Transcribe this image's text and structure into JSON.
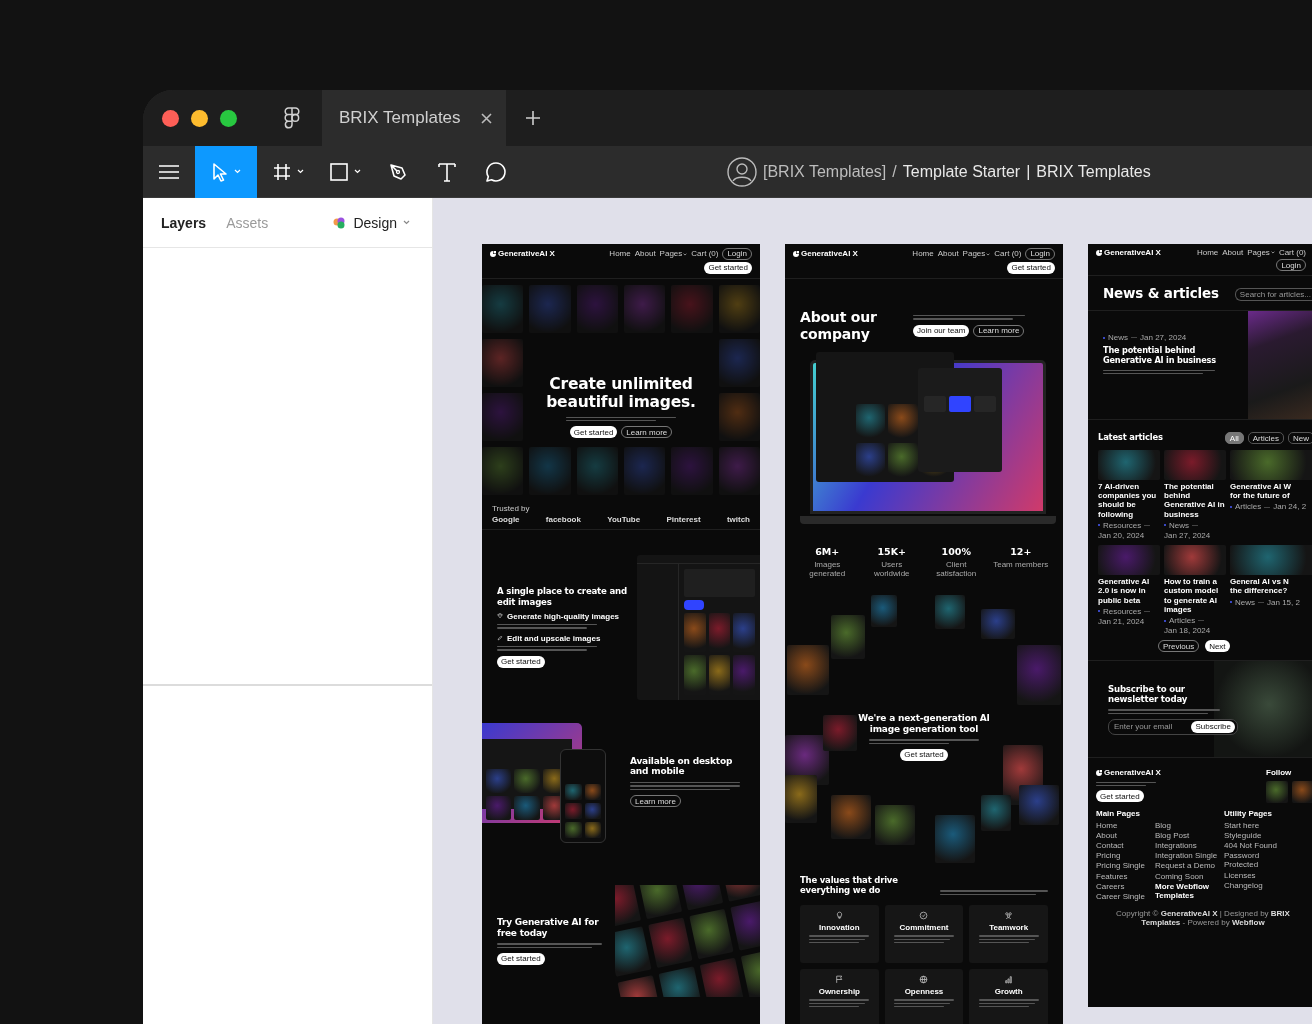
{
  "app": {
    "tab": {
      "title": "BRIX Templates"
    },
    "breadcrumb": {
      "team": "[BRIX Templates]",
      "separator": "/",
      "file": "Template Starter",
      "divider": "|",
      "project": "BRIX Templates"
    }
  },
  "toolbar": {
    "tools": [
      {
        "kind": "move",
        "selected": true,
        "menu": true
      },
      {
        "kind": "frame",
        "selected": false,
        "menu": true
      },
      {
        "kind": "shape",
        "selected": false,
        "menu": true
      },
      {
        "kind": "pen",
        "selected": false,
        "menu": false
      },
      {
        "kind": "text",
        "selected": false,
        "menu": false
      },
      {
        "kind": "comment",
        "selected": false,
        "menu": false
      }
    ]
  },
  "panel": {
    "tabs": [
      {
        "label": "Layers",
        "selected": true
      },
      {
        "label": "Assets",
        "selected": false
      }
    ],
    "mode": "Design"
  },
  "frames": [
    {
      "nav": {
        "logo": "GenerativeAI X",
        "links": [
          {
            "label": "Home",
            "dropdown": false
          },
          {
            "label": "About",
            "dropdown": false
          },
          {
            "label": "Pages",
            "dropdown": true
          },
          {
            "label": "Cart (0)",
            "dropdown": false
          }
        ],
        "buttons": [
          "Login",
          "Get started"
        ]
      },
      "sections": [
        {
          "kind": "hero",
          "title": "Create unlimited beautiful images.",
          "buttons": [
            "Get started",
            "Learn more"
          ],
          "trusted_label": "Trusted by",
          "logos": [
            "Google",
            "facebook",
            "YouTube",
            "Pinterest",
            "twitch"
          ]
        },
        {
          "kind": "feature",
          "title": "A single place to create and edit images",
          "items": [
            {
              "title": "Generate high-quality images"
            },
            {
              "title": "Edit and upscale images"
            }
          ],
          "button": "Get started"
        },
        {
          "kind": "devices",
          "title": "Available on desktop and mobile",
          "button": "Learn more"
        },
        {
          "kind": "cta",
          "title": "Try Generative AI for free today",
          "button": "Get started"
        }
      ]
    },
    {
      "nav": {
        "logo": "GenerativeAI X",
        "links": [
          {
            "label": "Home",
            "dropdown": false
          },
          {
            "label": "About",
            "dropdown": false
          },
          {
            "label": "Pages",
            "dropdown": true
          },
          {
            "label": "Cart (0)",
            "dropdown": false
          }
        ],
        "buttons": [
          "Login",
          "Get started"
        ]
      },
      "sections": [
        {
          "kind": "about",
          "title": "About our company",
          "buttons": [
            "Join our team",
            "Learn more"
          ]
        },
        {
          "kind": "stats",
          "items": [
            {
              "value": "6M+",
              "label": "Images generated"
            },
            {
              "value": "15K+",
              "label": "Users worldwide"
            },
            {
              "value": "100%",
              "label": "Client satisfaction"
            },
            {
              "value": "12+",
              "label": "Team members"
            }
          ]
        },
        {
          "kind": "collage",
          "title": "We're a next-generation AI image generation tool",
          "button": "Get started"
        },
        {
          "kind": "values",
          "title": "The values that drive everything we do",
          "cards": [
            {
              "title": "Innovation"
            },
            {
              "title": "Commitment"
            },
            {
              "title": "Teamwork"
            },
            {
              "title": "Ownership"
            },
            {
              "title": "Openness"
            },
            {
              "title": "Growth"
            }
          ]
        }
      ]
    },
    {
      "nav": {
        "logo": "GenerativeAI X",
        "links": [
          {
            "label": "Home",
            "dropdown": false
          },
          {
            "label": "About",
            "dropdown": false
          },
          {
            "label": "Pages",
            "dropdown": true
          },
          {
            "label": "Cart (0)",
            "dropdown": false
          }
        ],
        "buttons": [
          "Login"
        ]
      },
      "sections": [
        {
          "kind": "page-title",
          "title": "News & articles",
          "search_placeholder": "Search for articles..."
        },
        {
          "kind": "featured",
          "tag": "News",
          "date": "Jan 27, 2024",
          "title": "The potential behind Generative AI in business"
        },
        {
          "kind": "articles",
          "title": "Latest articles",
          "filters": [
            {
              "label": "All",
              "selected": true
            },
            {
              "label": "Articles",
              "selected": false
            },
            {
              "label": "New",
              "selected": false
            }
          ],
          "posts": [
            {
              "title": "7 AI-driven companies you should be following",
              "tag": "Resources",
              "date": "Jan 20, 2024"
            },
            {
              "title": "The potential behind Generative AI in business",
              "tag": "News",
              "date": "Jan 27, 2024"
            },
            {
              "title": "Generative AI W\nfor the future of",
              "tag": "Articles",
              "date": "Jan 24, 2"
            },
            {
              "title": "Generative AI 2.0 is now in public beta",
              "tag": "Resources",
              "date": "Jan 21, 2024"
            },
            {
              "title": "How to train a custom model to generate AI images",
              "tag": "Articles",
              "date": "Jan 18, 2024"
            },
            {
              "title": "General AI vs N\nthe difference?",
              "tag": "News",
              "date": "Jan 15, 2"
            }
          ],
          "pagination": [
            "Previous",
            "Next"
          ]
        },
        {
          "kind": "newsletter",
          "title": "Subscribe to our newsletter today",
          "placeholder": "Enter your email",
          "button": "Subscribe"
        },
        {
          "kind": "footer",
          "logo": "GenerativeAI X",
          "button": "Get started",
          "columns": [
            {
              "title": "Main Pages",
              "lists": [
                [
                  "Home",
                  "About",
                  "Contact",
                  "Pricing",
                  "Pricing Single",
                  "Features",
                  "Careers",
                  "Career Single"
                ],
                [
                  "Blog",
                  "Blog Post",
                  "Integrations",
                  "Integration Single",
                  "Request a Demo",
                  "Coming Soon"
                ]
              ],
              "featured_link": "More Webflow Templates"
            },
            {
              "title": "Utility Pages",
              "lists": [
                [
                  "Start here",
                  "Styleguide",
                  "404 Not Found",
                  "Password Protected",
                  "Licenses",
                  "Changelog"
                ]
              ]
            }
          ],
          "follow": "Follow",
          "copyright": "Copyright © **GenerativeAI X** | Designed by **BRIX Templates** - Powered by **Webflow**"
        }
      ]
    }
  ]
}
